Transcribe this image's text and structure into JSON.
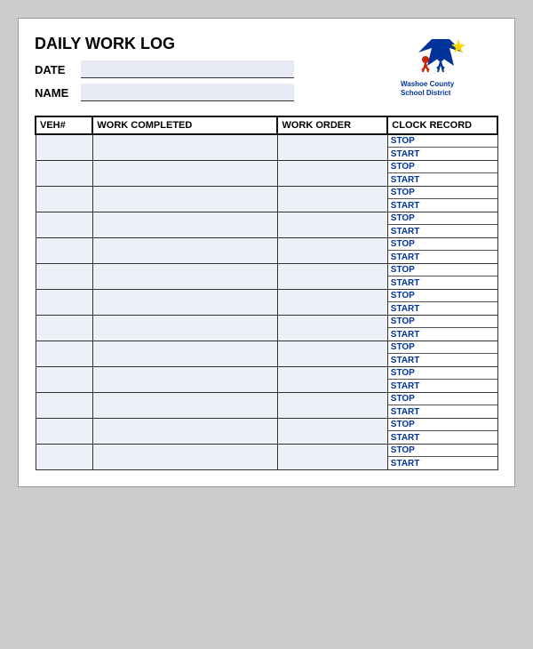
{
  "title": "DAILY WORK LOG",
  "fields": {
    "date_label": "DATE",
    "name_label": "NAME"
  },
  "logo": {
    "line1": "Washoe County",
    "line2": "School District"
  },
  "table": {
    "headers": [
      "VEH#",
      "WORK COMPLETED",
      "WORK ORDER",
      "CLOCK RECORD"
    ],
    "clock_labels": [
      "STOP",
      "START"
    ],
    "rows": 13
  }
}
